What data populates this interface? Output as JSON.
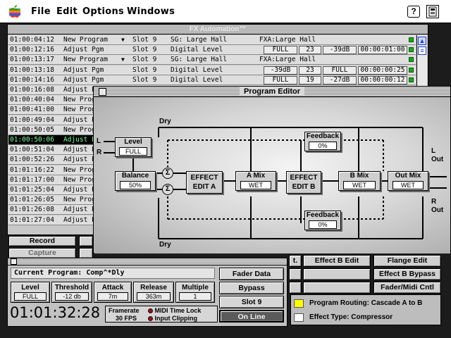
{
  "menubar": {
    "items": [
      "File",
      "Edit",
      "Options",
      "Windows"
    ],
    "help_icon": "?"
  },
  "fx_window": {
    "title": "FX Automation™",
    "rows": [
      {
        "time": "01:00:04:12",
        "event": "New Program",
        "arrow": true,
        "slot": "Slot 9",
        "desc": "SG: Large Hall",
        "extra": "FXA:Large Hall",
        "green": true
      },
      {
        "time": "01:00:12:16",
        "event": "Adjust Pgm",
        "slot": "Slot 9",
        "desc": "Digital Level",
        "cells": [
          "FULL",
          "23",
          "-39dB",
          "00:00:01:00"
        ],
        "green": true
      },
      {
        "time": "01:00:13:17",
        "event": "New Program",
        "arrow": true,
        "slot": "Slot 9",
        "desc": "SG: Large Hall",
        "extra": "FXA:Large Hall",
        "green": true
      },
      {
        "time": "01:00:13:18",
        "event": "Adjust Pgm",
        "slot": "Slot 9",
        "desc": "Digital Level",
        "cells": [
          "-39dB",
          "23",
          "FULL",
          "00:00:00:25"
        ],
        "green": true
      },
      {
        "time": "01:00:14:16",
        "event": "Adjust Pgm",
        "slot": "Slot 9",
        "desc": "Digital Level",
        "cells": [
          "FULL",
          "19",
          "-27dB",
          "00:00:00:12"
        ],
        "green": true
      },
      {
        "time": "01:00:16:08",
        "event": "Adjust Pgm",
        "selected": false
      },
      {
        "time": "01:00:40:04",
        "event": "New Prog"
      },
      {
        "time": "01:00:41:00",
        "event": "New Prog"
      },
      {
        "time": "01:00:49:04",
        "event": "Adjust P"
      },
      {
        "time": "01:00:50:05",
        "event": "New Prog"
      },
      {
        "time": "01:00:50:06",
        "event": "Adjust P",
        "selected": true
      },
      {
        "time": "01:00:51:04",
        "event": "Adjust P"
      },
      {
        "time": "01:00:52:26",
        "event": "Adjust P"
      },
      {
        "time": "01:01:16:22",
        "event": "New Prog"
      },
      {
        "time": "01:01:17:00",
        "event": "New Prog"
      },
      {
        "time": "01:01:25:04",
        "event": "Adjust P"
      },
      {
        "time": "01:01:26:05",
        "event": "New Prog"
      },
      {
        "time": "01:01:26:08",
        "event": "Adjust P"
      },
      {
        "time": "01:01:27:04",
        "event": "Adjust P"
      }
    ],
    "record_label": "Record",
    "capture_label": "Capture"
  },
  "program_editor": {
    "title": "Program Editor",
    "dry_top": "Dry",
    "dry_bottom": "Dry",
    "input_l": "L",
    "input_r": "R",
    "out_l": "L\nOut",
    "out_r": "R\nOut",
    "level": {
      "label": "Level",
      "value": "FULL"
    },
    "balance": {
      "label": "Balance",
      "value": "50%"
    },
    "effect_a": "EFFECT\nEDIT A",
    "a_mix": {
      "label": "A Mix",
      "value": "WET"
    },
    "effect_b": "EFFECT\nEDIT B",
    "b_mix": {
      "label": "B Mix",
      "value": "WET"
    },
    "out_mix": {
      "label": "Out Mix",
      "value": "WET"
    },
    "feedback_top": {
      "label": "Feedback",
      "value": "0%"
    },
    "feedback_bottom": {
      "label": "Feedback",
      "value": "0%"
    },
    "sum_symbol": "Σ"
  },
  "right_buttons": {
    "effect_b_edit": "Effect B Edit",
    "flange_edit": "Flange Edit",
    "effect_b_bypass": "Effect B Bypass",
    "fader_midi": "Fader/Midi Cntl",
    "partial_it": "t."
  },
  "current_program": {
    "label": "Current Program:",
    "value": "Comp^*Dly",
    "params": [
      {
        "label": "Level",
        "value": "FULL"
      },
      {
        "label": "Threshold",
        "value": "-12 db"
      },
      {
        "label": "Attack",
        "value": "7m"
      },
      {
        "label": "Release",
        "value": "363m"
      },
      {
        "label": "Multiple",
        "value": "1"
      }
    ],
    "timecode": "01:01:32:28",
    "framerate_label": "Framerate",
    "framerate_value": "30 FPS",
    "midi_lock": "MIDI Time Lock",
    "input_clipping": "Input Clipping",
    "fader_data": "Fader Data",
    "bypass": "Bypass",
    "slot": "Slot 9",
    "online": "On Line"
  },
  "routing": {
    "program_routing": "Program Routing: Cascade A to B",
    "effect_type": "Effect Type: Compressor",
    "swatch_color": "#ffff00"
  },
  "colors": {
    "selected_row_text": "#7cff9c",
    "status_green": "#1fa51f",
    "scroll_blue": "#1c3cc8"
  }
}
